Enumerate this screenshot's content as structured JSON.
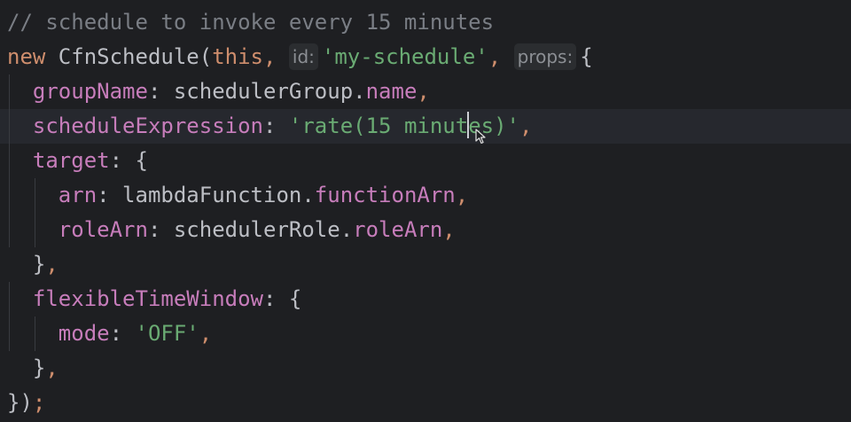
{
  "editor": {
    "lines": [
      {
        "tokens": [
          {
            "cls": "comment",
            "text": "// schedule to invoke every 15 minutes"
          }
        ]
      },
      {
        "tokens": [
          {
            "cls": "kw",
            "text": "new "
          },
          {
            "cls": "plain",
            "text": "CfnSchedule("
          },
          {
            "cls": "kw",
            "text": "this"
          },
          {
            "cls": "kw",
            "text": ", "
          },
          {
            "cls": "hint",
            "text": "id:"
          },
          {
            "cls": "str",
            "text": "'my-schedule'"
          },
          {
            "cls": "kw",
            "text": ", "
          },
          {
            "cls": "hint",
            "text": "props:"
          },
          {
            "cls": "plain",
            "text": "{"
          }
        ]
      },
      {
        "tokens": [
          {
            "cls": "plain",
            "text": "  "
          },
          {
            "cls": "prop",
            "text": "groupName"
          },
          {
            "cls": "plain",
            "text": ": schedulerGroup."
          },
          {
            "cls": "prop",
            "text": "name"
          },
          {
            "cls": "kw",
            "text": ","
          }
        ]
      },
      {
        "tokens": [
          {
            "cls": "plain",
            "text": "  "
          },
          {
            "cls": "prop",
            "text": "scheduleExpression"
          },
          {
            "cls": "plain",
            "text": ": "
          },
          {
            "cls": "str",
            "text": "'rate(15 minut"
          },
          {
            "cls": "caret",
            "text": ""
          },
          {
            "cls": "str",
            "text": "es)'"
          },
          {
            "cls": "kw",
            "text": ","
          }
        ]
      },
      {
        "tokens": [
          {
            "cls": "plain",
            "text": "  "
          },
          {
            "cls": "prop",
            "text": "target"
          },
          {
            "cls": "plain",
            "text": ": {"
          }
        ]
      },
      {
        "tokens": [
          {
            "cls": "plain",
            "text": "    "
          },
          {
            "cls": "prop",
            "text": "arn"
          },
          {
            "cls": "plain",
            "text": ": lambdaFunction."
          },
          {
            "cls": "prop",
            "text": "functionArn"
          },
          {
            "cls": "kw",
            "text": ","
          }
        ]
      },
      {
        "tokens": [
          {
            "cls": "plain",
            "text": "    "
          },
          {
            "cls": "prop",
            "text": "roleArn"
          },
          {
            "cls": "plain",
            "text": ": schedulerRole."
          },
          {
            "cls": "prop",
            "text": "roleArn"
          },
          {
            "cls": "kw",
            "text": ","
          }
        ]
      },
      {
        "tokens": [
          {
            "cls": "plain",
            "text": "  }"
          },
          {
            "cls": "kw",
            "text": ","
          }
        ]
      },
      {
        "tokens": [
          {
            "cls": "plain",
            "text": "  "
          },
          {
            "cls": "prop",
            "text": "flexibleTimeWindow"
          },
          {
            "cls": "plain",
            "text": ": {"
          }
        ]
      },
      {
        "tokens": [
          {
            "cls": "plain",
            "text": "    "
          },
          {
            "cls": "prop",
            "text": "mode"
          },
          {
            "cls": "plain",
            "text": ": "
          },
          {
            "cls": "str",
            "text": "'OFF'"
          },
          {
            "cls": "kw",
            "text": ","
          }
        ]
      },
      {
        "tokens": [
          {
            "cls": "plain",
            "text": "  }"
          },
          {
            "cls": "kw",
            "text": ","
          }
        ]
      },
      {
        "tokens": [
          {
            "cls": "plain",
            "text": "})"
          },
          {
            "cls": "kw",
            "text": ";"
          }
        ]
      }
    ],
    "current_line": 3,
    "colors": {
      "background": "#1e1f22",
      "current_line": "#26282e",
      "comment": "#7a7e85",
      "keyword": "#cf8e6d",
      "string": "#6aab73",
      "property": "#c77dbb",
      "plain": "#bcbec4",
      "hint_bg": "#2b2d30",
      "hint_fg": "#8c8f94"
    },
    "mouse_cursor_icon": "mouse-pointer-icon"
  }
}
